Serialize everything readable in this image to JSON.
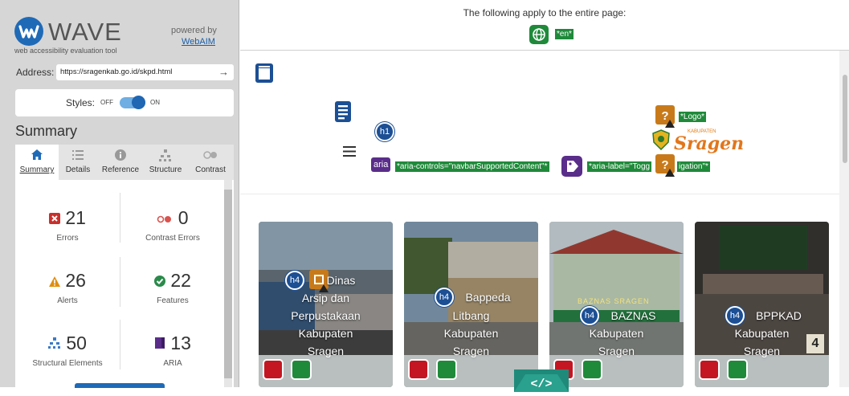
{
  "app": {
    "title": "WAVE",
    "tagline": "web accessibility evaluation tool",
    "powered_by": "powered by",
    "webaim": "WebAIM"
  },
  "address": {
    "label": "Address:",
    "value": "https://sragenkab.go.id/skpd.html",
    "go": "→"
  },
  "styles": {
    "label": "Styles:",
    "off": "OFF",
    "on": "ON",
    "enabled": true
  },
  "summary_heading": "Summary",
  "tabs": [
    {
      "label": "Summary",
      "icon": "home-icon",
      "active": true
    },
    {
      "label": "Details",
      "icon": "list-icon",
      "active": false
    },
    {
      "label": "Reference",
      "icon": "info-icon",
      "active": false
    },
    {
      "label": "Structure",
      "icon": "structure-icon",
      "active": false
    },
    {
      "label": "Contrast",
      "icon": "contrast-icon",
      "active": false
    }
  ],
  "stats": [
    {
      "value": "21",
      "label": "Errors",
      "icon": "error-icon",
      "color": "#c9302c"
    },
    {
      "value": "0",
      "label": "Contrast Errors",
      "icon": "contrast-error-icon",
      "color": "#d9534f"
    },
    {
      "value": "26",
      "label": "Alerts",
      "icon": "alert-icon",
      "color": "#e08e0b"
    },
    {
      "value": "22",
      "label": "Features",
      "icon": "feature-icon",
      "color": "#2a8a4a"
    },
    {
      "value": "50",
      "label": "Structural Elements",
      "icon": "structure-icon",
      "color": "#3a7bc8"
    },
    {
      "value": "13",
      "label": "ARIA",
      "icon": "aria-icon",
      "color": "#5a2d8a"
    }
  ],
  "banner": {
    "text": "The following apply to the entire page:",
    "lang": "*en*"
  },
  "header_tags": {
    "h1": "h1",
    "logo": "*Logo*",
    "aria_badge": "aria",
    "aria_controls": "*aria-controls=\"navbarSupportedContent\"*",
    "aria_label_a": "*aria-label=\"Togg",
    "aria_label_b": "igation\"*",
    "site_small": "KABUPATEN",
    "site_name": "Sragen"
  },
  "cards": [
    {
      "heading": "h4",
      "lines": [
        "Dinas",
        "Arsip dan",
        "Perpustakaan",
        "Kabupaten",
        "Sragen"
      ]
    },
    {
      "heading": "h4",
      "lines": [
        "Bappeda",
        "Litbang",
        "Kabupaten",
        "Sragen"
      ]
    },
    {
      "heading": "h4",
      "lines": [
        "BAZNAS",
        "Kabupaten",
        "Sragen"
      ],
      "sign": "BAZNAS SRAGEN"
    },
    {
      "heading": "h4",
      "lines": [
        "BPPKAD",
        "Kabupaten",
        "Sragen"
      ],
      "badge": "4"
    }
  ],
  "code_toggle": "</>",
  "colors": {
    "wave_blue": "#1f6ab7",
    "error_red": "#c41622",
    "feature_green": "#1f8a3a",
    "aria_purple": "#5a2d8a",
    "heading_blue": "#1c4f94",
    "alert_orange": "#c87a1a"
  }
}
